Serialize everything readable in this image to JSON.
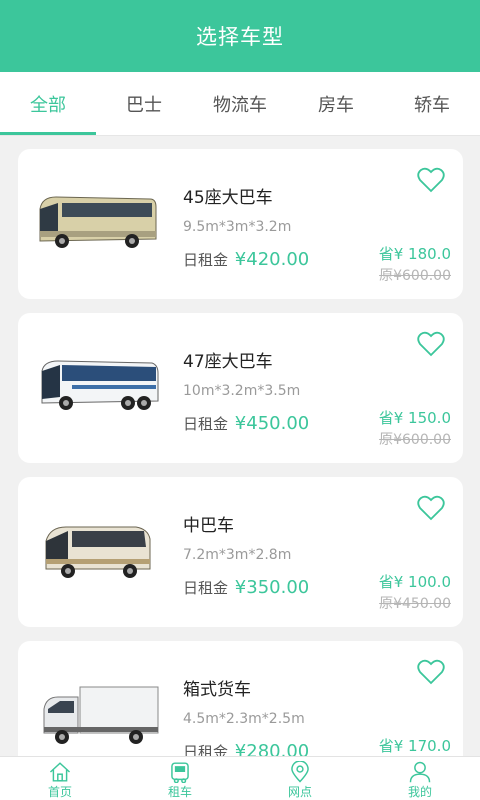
{
  "header": {
    "title": "选择车型"
  },
  "tabs": [
    {
      "label": "全部",
      "active": true
    },
    {
      "label": "巴士",
      "active": false
    },
    {
      "label": "物流车",
      "active": false
    },
    {
      "label": "房车",
      "active": false
    },
    {
      "label": "轿车",
      "active": false
    }
  ],
  "cars": [
    {
      "name": "45座大巴车",
      "size": "9.5m*3m*3.2m",
      "rent_label": "日租金",
      "price": "¥420.00",
      "save": "省¥ 180.0",
      "original": "原¥600.00",
      "image": "coach-bus-icon"
    },
    {
      "name": "47座大巴车",
      "size": "10m*3.2m*3.5m",
      "rent_label": "日租金",
      "price": "¥450.00",
      "save": "省¥ 150.0",
      "original": "原¥600.00",
      "image": "coach-bus-icon"
    },
    {
      "name": "中巴车",
      "size": "7.2m*3m*2.8m",
      "rent_label": "日租金",
      "price": "¥350.00",
      "save": "省¥ 100.0",
      "original": "原¥450.00",
      "image": "minibus-icon"
    },
    {
      "name": "箱式货车",
      "size": "4.5m*2.3m*2.5m",
      "rent_label": "日租金",
      "price": "¥280.00",
      "save": "省¥ 170.0",
      "original": "",
      "image": "box-truck-icon"
    }
  ],
  "bottom_nav": [
    {
      "label": "首页",
      "icon": "home-icon"
    },
    {
      "label": "租车",
      "icon": "car-rent-icon"
    },
    {
      "label": "网点",
      "icon": "location-icon"
    },
    {
      "label": "我的",
      "icon": "user-icon"
    }
  ],
  "colors": {
    "accent": "#3cc69b",
    "background": "#f1f1f1"
  }
}
